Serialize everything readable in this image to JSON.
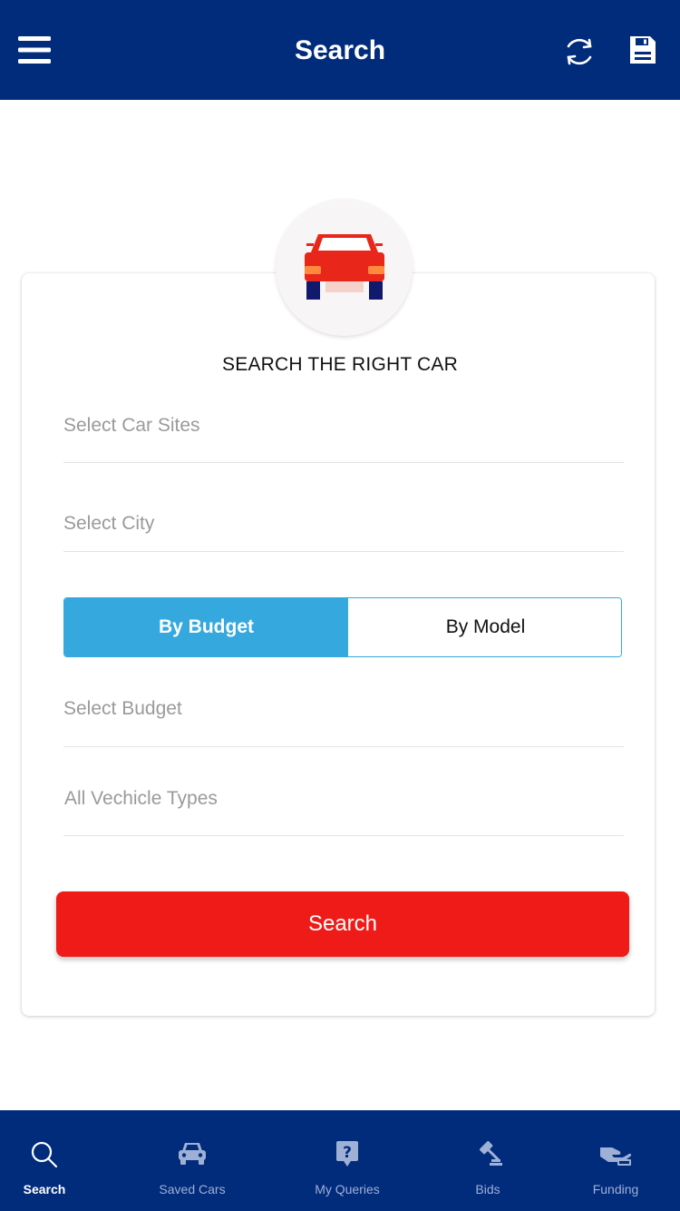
{
  "header": {
    "title": "Search",
    "menu_icon": "hamburger-menu-icon",
    "refresh_icon": "refresh-icon",
    "save_icon": "floppy-disk-icon"
  },
  "card": {
    "logo_icon": "car-front-icon",
    "title": "SEARCH THE RIGHT CAR",
    "fields": {
      "car_sites": "Select Car Sites",
      "city": "Select City",
      "budget": "Select Budget",
      "vehicle_types": "All Vechicle Types"
    },
    "toggle": {
      "by_budget": "By Budget",
      "by_model": "By Model",
      "selected": "By Budget"
    },
    "search_button": "Search"
  },
  "bottom_nav": {
    "items": [
      {
        "label": "Search",
        "icon": "search-icon",
        "active": true
      },
      {
        "label": "Saved Cars",
        "icon": "car-icon",
        "active": false
      },
      {
        "label": "My Queries",
        "icon": "question-icon",
        "active": false
      },
      {
        "label": "Bids",
        "icon": "gavel-icon",
        "active": false
      },
      {
        "label": "Funding",
        "icon": "funding-hand-icon",
        "active": false
      }
    ]
  },
  "colors": {
    "header_bg": "#012b7b",
    "accent_blue": "#35a9de",
    "search_red": "#ee1b18",
    "car_red": "#e8261a",
    "nav_inactive": "#9fb0d6"
  }
}
